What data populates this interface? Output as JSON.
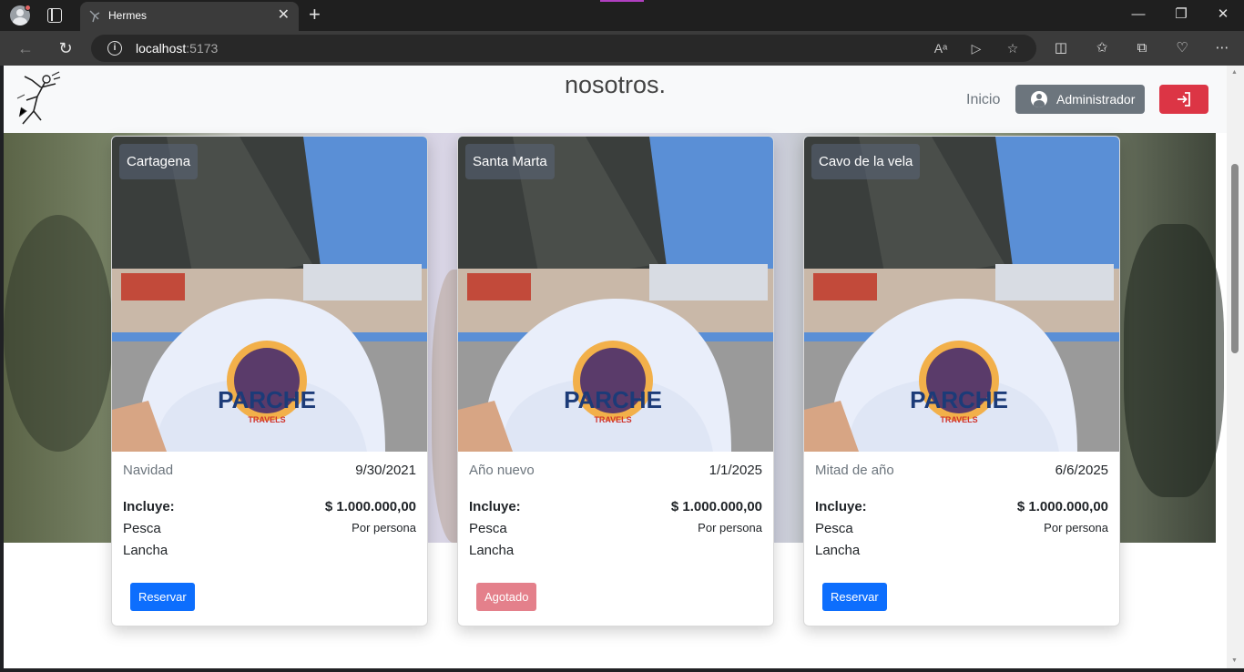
{
  "browser": {
    "tab_title": "Hermes",
    "url_host": "localhost",
    "url_port": ":5173",
    "accent_color": "#b03fc0"
  },
  "navbar": {
    "title": "nosotros.",
    "inicio": "Inicio",
    "admin_label": "Administrador",
    "admin_color": "#6c757d",
    "login_color": "#dc3545"
  },
  "cards": [
    {
      "city": "Cartagena",
      "season": "Navidad",
      "date": "9/30/2021",
      "incluye_label": "Incluye:",
      "price": "$ 1.000.000,00",
      "per": "Por persona",
      "includes": [
        "Pesca",
        "Lancha"
      ],
      "button": "Reservar",
      "status": "available"
    },
    {
      "city": "Santa Marta",
      "season": "Año nuevo",
      "date": "1/1/2025",
      "incluye_label": "Incluye:",
      "price": "$ 1.000.000,00",
      "per": "Por persona",
      "includes": [
        "Pesca",
        "Lancha"
      ],
      "button": "Agotado",
      "status": "sold-out"
    },
    {
      "city": "Cavo de la vela",
      "season": "Mitad de año",
      "date": "6/6/2025",
      "incluye_label": "Incluye:",
      "price": "$ 1.000.000,00",
      "per": "Por persona",
      "includes": [
        "Pesca",
        "Lancha"
      ],
      "button": "Reservar",
      "status": "available"
    }
  ],
  "image_text": {
    "brand": "PARCHE",
    "sub": "TRAVELS"
  },
  "colors": {
    "reservar": "#0d6efd",
    "agotado": "#e4808b"
  }
}
